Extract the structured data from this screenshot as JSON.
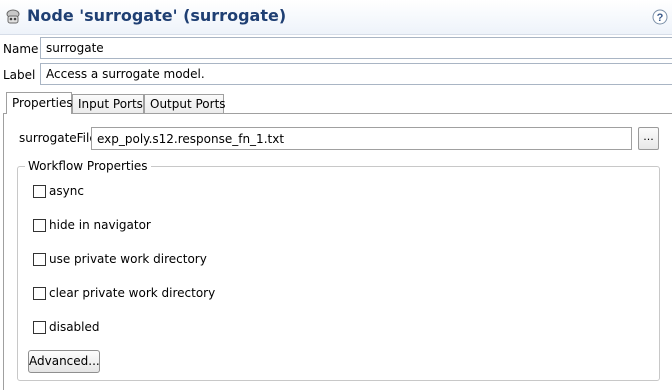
{
  "header": {
    "title": "Node 'surrogate' (surrogate)",
    "icon": "node-icon",
    "help_icon": "help-icon"
  },
  "form": {
    "name_label": "Name",
    "name_value": "surrogate",
    "label_label": "Label",
    "label_value": "Access a surrogate model."
  },
  "tabs": [
    {
      "label": "Properties",
      "active": true
    },
    {
      "label": "Input Ports",
      "active": false
    },
    {
      "label": "Output Ports",
      "active": false
    }
  ],
  "properties": {
    "surrogate_file_label": "surrogateFile",
    "surrogate_file_value": "exp_poly.s12.response_fn_1.txt",
    "browse_label": "..."
  },
  "workflow": {
    "group_title": "Workflow Properties",
    "checkboxes": [
      {
        "label": "async",
        "checked": false
      },
      {
        "label": "hide in navigator",
        "checked": false
      },
      {
        "label": "use private work directory",
        "checked": false
      },
      {
        "label": "clear private work directory",
        "checked": false
      },
      {
        "label": "disabled",
        "checked": false
      }
    ],
    "advanced_label": "Advanced..."
  }
}
